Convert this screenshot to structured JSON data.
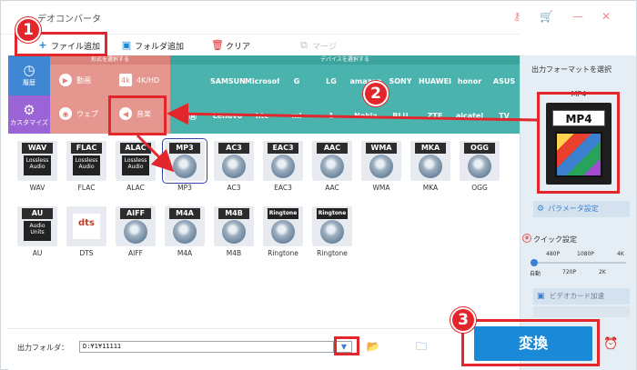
{
  "window": {
    "title": "デオコンバータ"
  },
  "toolbar": {
    "add_file": "ファイル追加",
    "add_folder": "フォルダ追加",
    "clear": "クリア",
    "merge": "マージ"
  },
  "categories": {
    "history": "履歴",
    "custom": "カスタマイズ",
    "format_header": "形式を選択する",
    "device_header": "デバイスを選択する",
    "format_items": [
      {
        "label": "動画",
        "icon": "play-icon"
      },
      {
        "label": "4K/HD",
        "icon": "4k-icon"
      },
      {
        "label": "ウェブ",
        "icon": "chrome-icon"
      },
      {
        "label": "音楽",
        "icon": "speaker-icon"
      }
    ],
    "device_row1": [
      "",
      "SAMSUNG",
      "Microsoft",
      "G",
      "LG",
      "amazon",
      "SONY",
      "HUAWEI",
      "honor",
      "ASUS"
    ],
    "device_row2": [
      "",
      "Lenovo",
      "htc",
      "mi",
      "1",
      "Nokia",
      "BLU",
      "ZTE",
      "alcatel",
      "TV"
    ]
  },
  "formats": [
    {
      "tag": "WAV",
      "name": "WAV",
      "sub": "Lossless Audio"
    },
    {
      "tag": "FLAC",
      "name": "FLAC",
      "sub": "Lossless Audio"
    },
    {
      "tag": "ALAC",
      "name": "ALAC",
      "sub": "Lossless Audio"
    },
    {
      "tag": "MP3",
      "name": "MP3",
      "sub": ""
    },
    {
      "tag": "AC3",
      "name": "AC3",
      "sub": ""
    },
    {
      "tag": "EAC3",
      "name": "EAC3",
      "sub": ""
    },
    {
      "tag": "AAC",
      "name": "AAC",
      "sub": ""
    },
    {
      "tag": "WMA",
      "name": "WMA",
      "sub": ""
    },
    {
      "tag": "MKA",
      "name": "MKA",
      "sub": ""
    },
    {
      "tag": "OGG",
      "name": "OGG",
      "sub": ""
    },
    {
      "tag": "AU",
      "name": "AU",
      "sub": "Audio Units"
    },
    {
      "tag": "",
      "name": "DTS",
      "sub": "dts"
    },
    {
      "tag": "AIFF",
      "name": "AIFF",
      "sub": ""
    },
    {
      "tag": "M4A",
      "name": "M4A",
      "sub": ""
    },
    {
      "tag": "M4B",
      "name": "M4B",
      "sub": ""
    },
    {
      "tag": "Ringtone",
      "name": "Ringtone",
      "sub": ""
    },
    {
      "tag": "Ringtone",
      "name": "Ringtone",
      "sub": ""
    }
  ],
  "output": {
    "label": "出力フォルダ：",
    "path": "D:¥1¥11111"
  },
  "right_panel": {
    "title": "出力フォーマットを選択",
    "format_name": "MP4",
    "format_badge": "MP4",
    "param_button": "パラメータ設定",
    "quick_label": "クイック設定",
    "slider_top": [
      "480P",
      "1080P",
      "4K"
    ],
    "slider_bottom": [
      "自動",
      "720P",
      "2K"
    ],
    "gpu_label": "ビデオカード加速"
  },
  "convert_button": "変換",
  "callouts": [
    "1",
    "2",
    "3"
  ],
  "colors": {
    "accent": "#1989d8",
    "callout": "#e3262b",
    "format_panel": "#e5968f",
    "device_panel": "#4bb3ad",
    "sidebar": "#3f86d3"
  }
}
